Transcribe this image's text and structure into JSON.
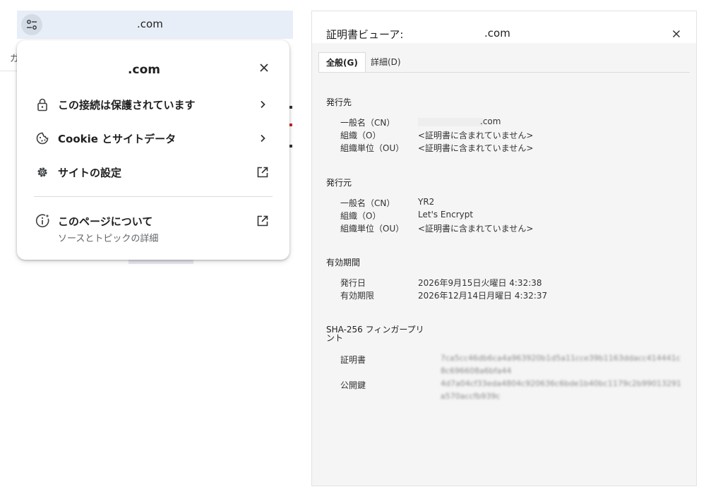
{
  "address_bar": {
    "url": ".com"
  },
  "background": {
    "partial_text": "ガ"
  },
  "site_popup": {
    "title": ".com",
    "items": [
      {
        "label": "この接続は保護されています",
        "icon": "lock-icon",
        "trailing": "chevron-right-icon"
      },
      {
        "label": "Cookie とサイトデータ",
        "icon": "cookie-icon",
        "trailing": "chevron-right-icon"
      },
      {
        "label": "サイトの設定",
        "icon": "gear-icon",
        "trailing": "open-external-icon"
      },
      {
        "label": "このページについて",
        "sublabel": "ソースとトピックの詳細",
        "icon": "page-info-icon",
        "trailing": "open-external-icon"
      }
    ]
  },
  "cert_viewer": {
    "title": "証明書ビューア:",
    "title_host": ".com",
    "tabs": [
      {
        "label": "全般(G)",
        "active": true
      },
      {
        "label": "詳細(D)",
        "active": false
      }
    ],
    "issued_to": {
      "heading": "発行先",
      "fields": [
        {
          "label": "一般名（CN）",
          "value": ".com"
        },
        {
          "label": "組織（O）",
          "value": "<証明書に含まれていません>"
        },
        {
          "label": "組織単位（OU）",
          "value": "<証明書に含まれていません>"
        }
      ]
    },
    "issued_by": {
      "heading": "発行元",
      "fields": [
        {
          "label": "一般名（CN）",
          "value": "YR2"
        },
        {
          "label": "組織（O）",
          "value": "Let's Encrypt"
        },
        {
          "label": "組織単位（OU）",
          "value": "<証明書に含まれていません>"
        }
      ]
    },
    "validity": {
      "heading": "有効期間",
      "fields": [
        {
          "label": "発行日",
          "value": "2026年9月15日火曜日 4:32:38"
        },
        {
          "label": "有効期限",
          "value": "2026年12月14日月曜日 4:32:37"
        }
      ]
    },
    "fingerprints": {
      "heading_line1": "SHA-256 フィンガープリ",
      "heading_line2": "ント",
      "fields": [
        {
          "label": "証明書",
          "value": "7ca5cc46db6ca4a963920b1d5a11cce39b1163ddacc414441c8c696608a6bfa44"
        },
        {
          "label": "公開鍵",
          "value": "4d7a04cf33eda4804c920636c6bde1b40bc1179c2b99013291a570accfb939c"
        }
      ]
    }
  },
  "colors": {
    "address_bar_bg": "#e8eef7",
    "dialog_bg": "#f5f5f5",
    "hash_text": "#8a8a8a"
  }
}
